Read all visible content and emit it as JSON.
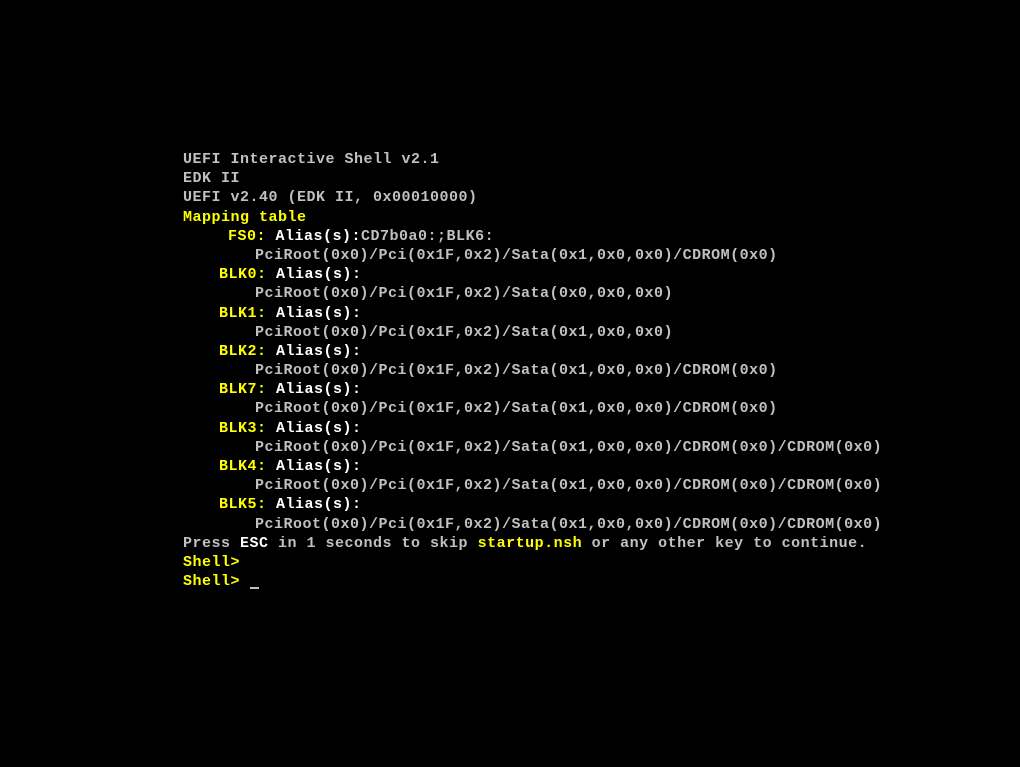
{
  "header": {
    "line1": "UEFI Interactive Shell v2.1",
    "line2": "EDK II",
    "line3": "UEFI v2.40 (EDK II, 0x00010000)"
  },
  "mapping_header": "Mapping table",
  "entries": [
    {
      "label": "FS0:",
      "alias_prefix": "Alias(s):",
      "alias_value": "CD7b0a0:;BLK6:",
      "path": "PciRoot(0x0)/Pci(0x1F,0x2)/Sata(0x1,0x0,0x0)/CDROM(0x0)"
    },
    {
      "label": "BLK0:",
      "alias_prefix": "Alias(s):",
      "alias_value": "",
      "path": "PciRoot(0x0)/Pci(0x1F,0x2)/Sata(0x0,0x0,0x0)"
    },
    {
      "label": "BLK1:",
      "alias_prefix": "Alias(s):",
      "alias_value": "",
      "path": "PciRoot(0x0)/Pci(0x1F,0x2)/Sata(0x1,0x0,0x0)"
    },
    {
      "label": "BLK2:",
      "alias_prefix": "Alias(s):",
      "alias_value": "",
      "path": "PciRoot(0x0)/Pci(0x1F,0x2)/Sata(0x1,0x0,0x0)/CDROM(0x0)"
    },
    {
      "label": "BLK7:",
      "alias_prefix": "Alias(s):",
      "alias_value": "",
      "path": "PciRoot(0x0)/Pci(0x1F,0x2)/Sata(0x1,0x0,0x0)/CDROM(0x0)"
    },
    {
      "label": "BLK3:",
      "alias_prefix": "Alias(s):",
      "alias_value": "",
      "path": "PciRoot(0x0)/Pci(0x1F,0x2)/Sata(0x1,0x0,0x0)/CDROM(0x0)/CDROM(0x0)"
    },
    {
      "label": "BLK4:",
      "alias_prefix": "Alias(s):",
      "alias_value": "",
      "path": "PciRoot(0x0)/Pci(0x1F,0x2)/Sata(0x1,0x0,0x0)/CDROM(0x0)/CDROM(0x0)"
    },
    {
      "label": "BLK5:",
      "alias_prefix": "Alias(s):",
      "alias_value": "",
      "path": "PciRoot(0x0)/Pci(0x1F,0x2)/Sata(0x1,0x0,0x0)/CDROM(0x0)/CDROM(0x0)"
    }
  ],
  "footer": {
    "press_prefix": "Press ",
    "esc": "ESC",
    "press_mid": " in 1 seconds to skip ",
    "startup": "startup.nsh",
    "press_suffix": " or any other key to continue."
  },
  "prompt": "Shell> "
}
